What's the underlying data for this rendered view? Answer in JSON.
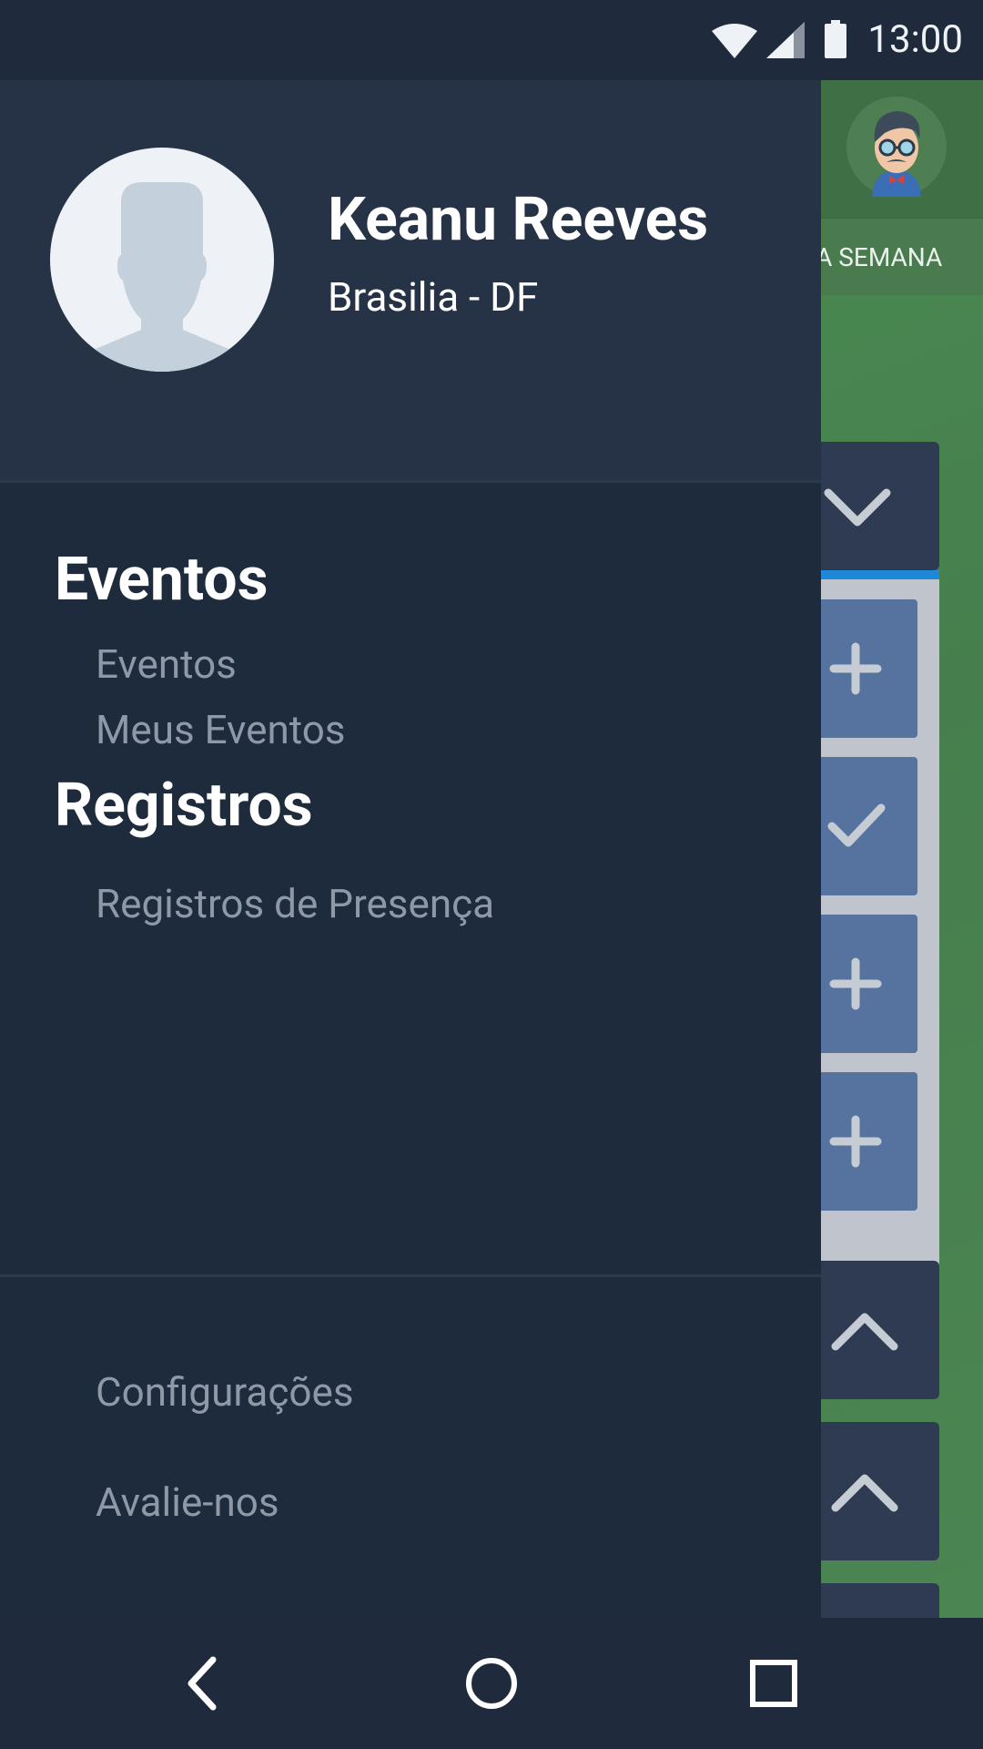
{
  "status_bar": {
    "time": "13:00",
    "icons": [
      "wifi-icon",
      "signal-icon",
      "battery-icon"
    ]
  },
  "background_app": {
    "tab_label": "DA SEMANA",
    "tiles": [
      "plus-icon",
      "check-icon",
      "plus-icon",
      "plus-icon"
    ],
    "colors": {
      "green": "#4a8a52",
      "panel": "#2f3b52",
      "tile": "#5673a0",
      "accent": "#1e88d8"
    }
  },
  "drawer": {
    "profile": {
      "name": "Keanu Reeves",
      "location": "Brasilia - DF"
    },
    "sections": [
      {
        "title": "Eventos",
        "items": [
          "Eventos",
          "Meus Eventos"
        ]
      },
      {
        "title": "Registros",
        "items": [
          "Registros de Presença"
        ]
      }
    ],
    "footer": [
      "Configurações",
      "Avalie-nos"
    ],
    "colors": {
      "background": "#1e2b3c",
      "header": "#263346",
      "muted_text": "#8e98a6"
    }
  },
  "nav_bar": {
    "buttons": [
      "back-icon",
      "home-icon",
      "recents-icon"
    ]
  }
}
